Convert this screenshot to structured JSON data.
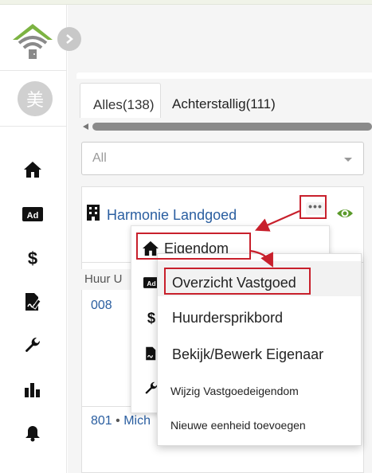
{
  "sidebar": {
    "avatar_text": "美",
    "icons": [
      "home-icon",
      "ad-icon",
      "dollar-icon",
      "document-edit-icon",
      "wrench-icon",
      "bar-chart-icon",
      "bell-icon"
    ],
    "icon_color": "#111111",
    "logo_colors": {
      "roof": "#7cb342",
      "wifi": "#888888"
    }
  },
  "tabs": [
    {
      "label": "Alles(138)",
      "active": true
    },
    {
      "label": "Achterstallig(111)",
      "active": false
    }
  ],
  "filter": {
    "selected": "All"
  },
  "card": {
    "property_name": "Harmonie Landgoed",
    "more_label": "•••",
    "column_header": "Huur U",
    "unit_1": "008",
    "unit_2_number": "801",
    "unit_2_sep": "•",
    "unit_2_name": "Mich",
    "link_color": "#2a5ea0",
    "eye_color": "#5a9a2a"
  },
  "menu": {
    "eigendom_label": "Eigendom",
    "submenu": [
      "Overzicht Vastgoed",
      "Huurdersprikbord",
      "Bekijk/Bewerk Eigenaar",
      "Wijzig Vastgoedeigendom",
      "Nieuwe eenheid toevoegen"
    ]
  },
  "annotation_color": "#c8202c"
}
